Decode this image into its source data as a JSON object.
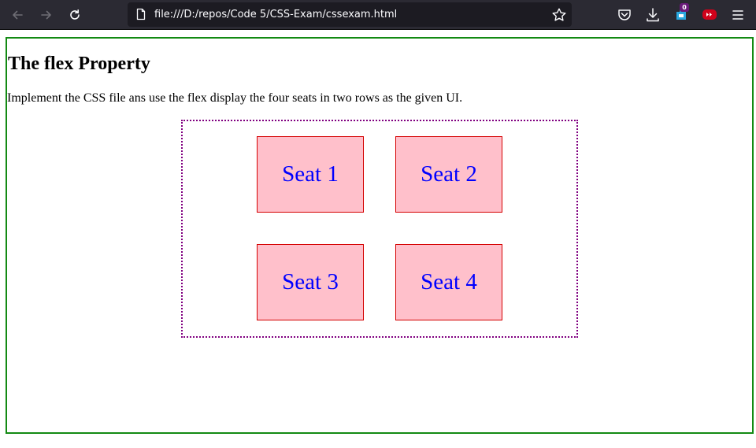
{
  "browser": {
    "url": "file:///D:/repos/Code 5/CSS-Exam/cssexam.html",
    "extension_badge": "0",
    "icons": {
      "back": "arrow-left-icon",
      "forward": "arrow-right-icon",
      "reload": "reload-icon",
      "page": "page-icon",
      "bookmark": "star-icon",
      "pocket": "pocket-icon",
      "downloads": "download-icon",
      "extension": "extension-icon",
      "video_extension": "video-extension-icon",
      "menu": "hamburger-menu-icon"
    }
  },
  "page": {
    "heading": "The flex Property",
    "description": "Implement the CSS file ans use the flex display the four seats in two rows as the given UI.",
    "seats": [
      "Seat 1",
      "Seat 2",
      "Seat 3",
      "Seat 4"
    ]
  },
  "colors": {
    "outer_border": "#138a13",
    "container_border": "#800080",
    "seat_background": "#ffc0cb",
    "seat_border": "#d40000",
    "seat_text": "#0000ff"
  }
}
